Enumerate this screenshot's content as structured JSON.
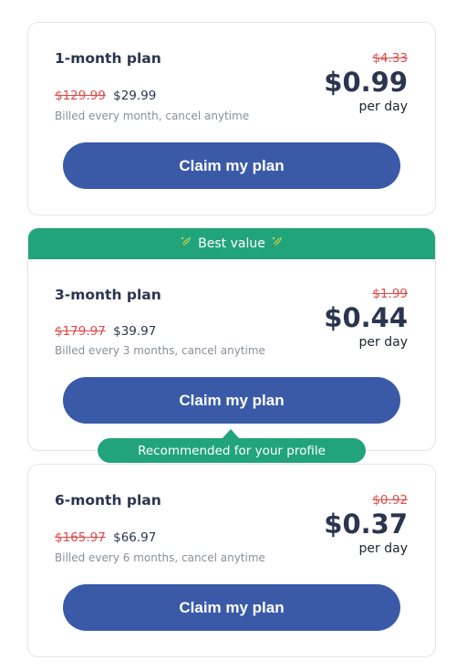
{
  "plans": [
    {
      "name": "1-month plan",
      "old_total": "$129.99",
      "new_total": "$29.99",
      "billing": "Billed every month, cancel anytime",
      "old_daily": "$4.33",
      "daily": "$0.99",
      "per_day": "per day",
      "cta": "Claim my plan"
    },
    {
      "banner": "Best value",
      "name": "3-month plan",
      "old_total": "$179.97",
      "new_total": "$39.97",
      "billing": "Billed every 3 months, cancel anytime",
      "old_daily": "$1.99",
      "daily": "$0.44",
      "per_day": "per day",
      "cta": "Claim my plan",
      "recommended": "Recommended for your profile"
    },
    {
      "name": "6-month plan",
      "old_total": "$165.97",
      "new_total": "$66.97",
      "billing": "Billed every 6 months, cancel anytime",
      "old_daily": "$0.92",
      "daily": "$0.37",
      "per_day": "per day",
      "cta": "Claim my plan"
    }
  ],
  "icons": {
    "banner_left": "leaf-sparkle-icon",
    "banner_right": "leaf-sparkle-icon"
  },
  "colors": {
    "accent_green": "#22a47b",
    "button_blue": "#3a5aa8",
    "strike_red": "#e04a4a",
    "text_dark": "#2a3550"
  }
}
